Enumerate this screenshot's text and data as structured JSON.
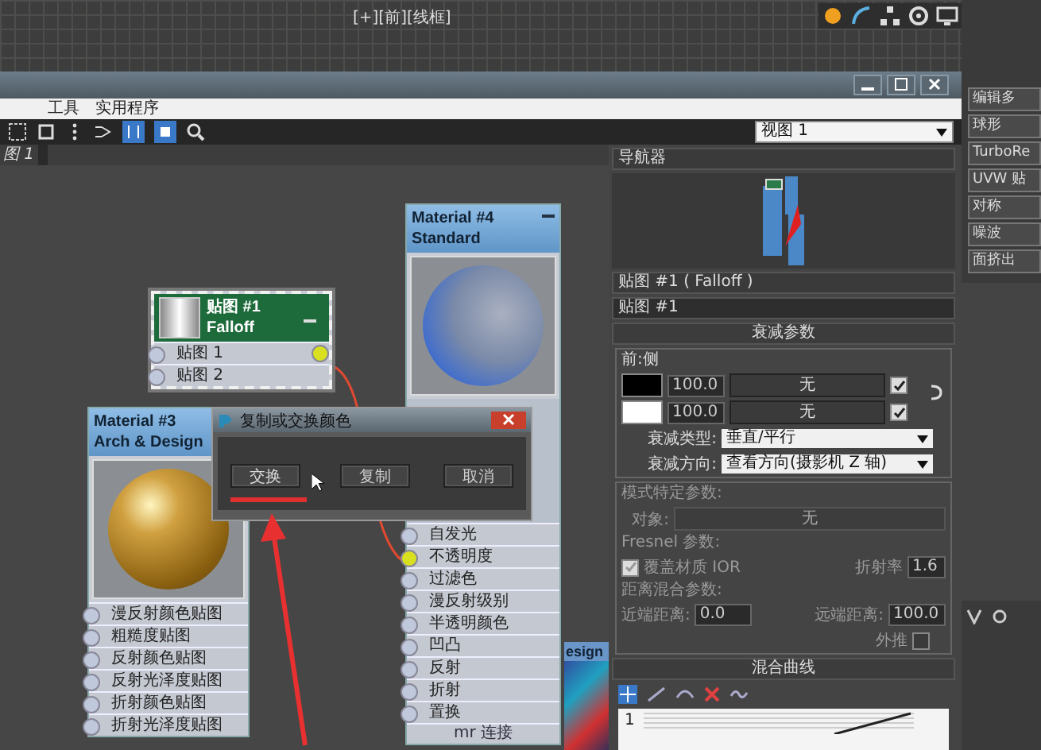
{
  "viewport": {
    "label": "[+][前][线框]"
  },
  "command_panel": {
    "modifiers": [
      "编辑多",
      "球形",
      "TurboRe",
      "UVW 贴",
      "对称",
      "噪波",
      "面挤出"
    ]
  },
  "editor": {
    "menu": [
      "工具",
      "实用程序"
    ],
    "view_select": "视图 1",
    "view_tab": "图 1"
  },
  "nodes": [
    {
      "kind": "arch_design",
      "title": "Material #3",
      "subtitle": "Arch & Design",
      "selected": false,
      "slots": [
        {
          "label": "漫反射颜色贴图",
          "connected": false
        },
        {
          "label": "粗糙度贴图",
          "connected": false
        },
        {
          "label": "反射颜色贴图",
          "connected": false
        },
        {
          "label": "反射光泽度贴图",
          "connected": false
        },
        {
          "label": "折射颜色贴图",
          "connected": false
        },
        {
          "label": "折射光泽度贴图",
          "connected": false
        }
      ]
    },
    {
      "kind": "map",
      "title": "贴图 #1",
      "subtitle": "Falloff",
      "selected": true,
      "slots": [
        {
          "label": "贴图 1",
          "connected": false
        },
        {
          "label": "贴图 2",
          "connected": false
        }
      ]
    },
    {
      "kind": "standard",
      "title": "Material #4",
      "subtitle": "Standard",
      "selected": false,
      "slots": [
        {
          "label": "自发光",
          "connected": false
        },
        {
          "label": "不透明度",
          "connected": true
        },
        {
          "label": "过滤色",
          "connected": false
        },
        {
          "label": "漫反射级别",
          "connected": false
        },
        {
          "label": "半透明颜色",
          "connected": false
        },
        {
          "label": "凹凸",
          "connected": false
        },
        {
          "label": "反射",
          "connected": false
        },
        {
          "label": "折射",
          "connected": false
        },
        {
          "label": "置换",
          "connected": false
        }
      ],
      "footer": "mr 连接"
    }
  ],
  "partial_node": {
    "title": "esign"
  },
  "dialog": {
    "title": "复制或交换颜色",
    "buttons": [
      {
        "label": "交换",
        "annotated": true
      },
      {
        "label": "复制",
        "annotated": false
      },
      {
        "label": "取消",
        "annotated": false
      }
    ]
  },
  "navigator": {
    "title": "导航器"
  },
  "params": {
    "header": "贴图 #1 ( Falloff )",
    "name": "贴图 #1",
    "rollout": "衰减参数",
    "group": "前:侧",
    "colors": [
      {
        "color": "#000000",
        "amount": "100.0",
        "map": "无",
        "checked": true
      },
      {
        "color": "#ffffff",
        "amount": "100.0",
        "map": "无",
        "checked": true
      }
    ],
    "falloff_type_label": "衰减类型:",
    "falloff_type": "垂直/平行",
    "falloff_dir_label": "衰减方向:",
    "falloff_dir": "查看方向(摄影机 Z 轴)",
    "mode_group": "模式特定参数:",
    "object_label": "对象:",
    "object": "无",
    "fresnel_group": "Fresnel 参数:",
    "override_ior": {
      "label": "覆盖材质 IOR",
      "checked": true
    },
    "ior_label": "折射率",
    "ior": "1.6",
    "distance_group": "距离混合参数:",
    "near_label": "近端距离:",
    "near": "0.0",
    "far_label": "远端距离:",
    "far": "100.0",
    "extrapolate": {
      "label": "外推",
      "checked": false
    },
    "curve_rollout": "混合曲线",
    "curve_axis": "1"
  }
}
